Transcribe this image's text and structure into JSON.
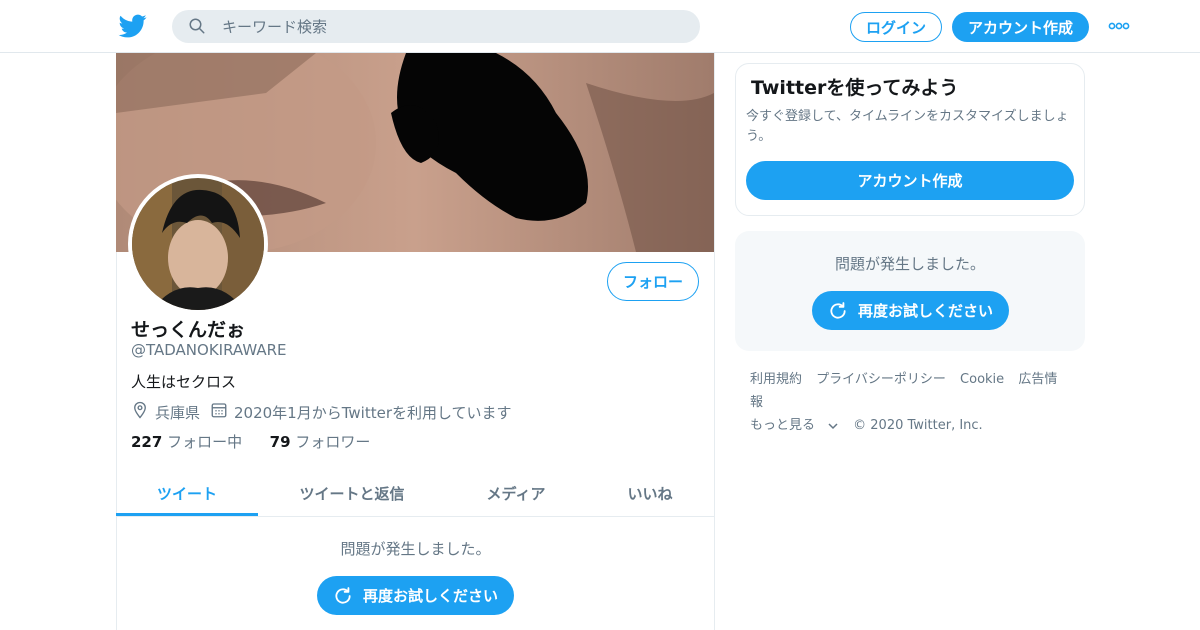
{
  "header": {
    "search_placeholder": "キーワード検索",
    "login_label": "ログイン",
    "signup_label": "アカウント作成"
  },
  "profile": {
    "name": "せっくんだぉ",
    "handle": "@TADANOKIRAWARE",
    "bio": "人生はセクロス",
    "location": "兵庫県",
    "joined": "2020年1月からTwitterを利用しています",
    "following_count": "227",
    "following_label": "フォロー中",
    "followers_count": "79",
    "followers_label": "フォロワー",
    "follow_label": "フォロー"
  },
  "tabs": [
    {
      "label": "ツイート",
      "active": true
    },
    {
      "label": "ツイートと返信",
      "active": false
    },
    {
      "label": "メディア",
      "active": false
    },
    {
      "label": "いいね",
      "active": false
    }
  ],
  "timeline": {
    "error": "問題が発生しました。",
    "retry_label": "再度お試しください"
  },
  "sidebar": {
    "signup_card": {
      "title": "Twitterを使ってみよう",
      "subtitle": "今すぐ登録して、タイムラインをカスタマイズしましょう。",
      "button_label": "アカウント作成"
    },
    "error_card": {
      "error": "問題が発生しました。",
      "retry_label": "再度お試しください"
    },
    "footer": {
      "links": [
        "利用規約",
        "プライバシーポリシー",
        "Cookie",
        "広告情報"
      ],
      "more_label": "もっと見る",
      "copyright": "© 2020 Twitter, Inc."
    }
  },
  "colors": {
    "accent": "#1da1f2",
    "text_primary": "#14171a",
    "text_secondary": "#657786",
    "search_bg": "#e6ecf0"
  },
  "icons": [
    "twitter-bird-icon",
    "search-icon",
    "more-dots-icon",
    "location-pin-icon",
    "calendar-icon",
    "refresh-icon",
    "chevron-down-icon"
  ]
}
